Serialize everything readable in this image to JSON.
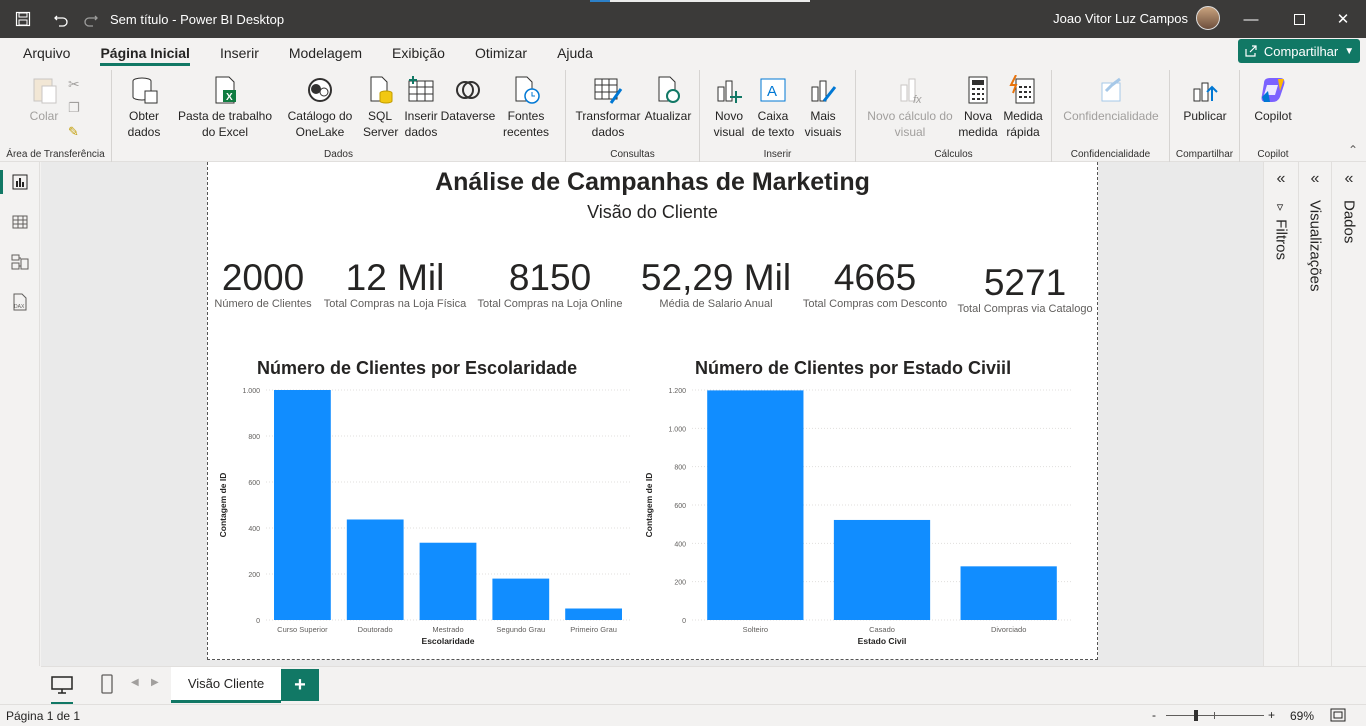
{
  "window": {
    "title": "Sem título - Power BI Desktop",
    "user": "Joao Vitor Luz Campos"
  },
  "ribbon_tabs": [
    "Arquivo",
    "Página Inicial",
    "Inserir",
    "Modelagem",
    "Exibição",
    "Otimizar",
    "Ajuda"
  ],
  "active_tab": "Página Inicial",
  "share_label": "Compartilhar",
  "ribbon": {
    "clipboard": {
      "paste": "Colar",
      "group": "Área de Transferência"
    },
    "data": {
      "get_data": "Obter dados",
      "excel": "Pasta de trabalho do Excel",
      "onelake": "Catálogo do OneLake",
      "sql": "SQL Server",
      "enter_data": "Inserir dados",
      "dataverse": "Dataverse",
      "recent": "Fontes recentes",
      "group": "Dados"
    },
    "queries": {
      "transform": "Transformar dados",
      "refresh": "Atualizar",
      "group": "Consultas"
    },
    "insert": {
      "new_visual": "Novo visual",
      "text_box": "Caixa de texto",
      "more_visuals": "Mais visuais",
      "group": "Inserir"
    },
    "calculations": {
      "new_calc": "Novo cálculo do visual",
      "new_measure": "Nova medida",
      "quick_measure": "Medida rápida",
      "group": "Cálculos"
    },
    "sensitivity": {
      "btn": "Confidencialidade",
      "group": "Confidencialidade"
    },
    "share": {
      "publish": "Publicar",
      "group": "Compartilhar"
    },
    "copilot": {
      "btn": "Copilot",
      "group": "Copilot"
    }
  },
  "report": {
    "title": "Análise de Campanhas de Marketing",
    "subtitle": "Visão do Cliente",
    "kpis": [
      {
        "value": "2000",
        "label": "Número de Clientes"
      },
      {
        "value": "12 Mil",
        "label": "Total Compras na Loja Física"
      },
      {
        "value": "8150",
        "label": "Total Compras na Loja Online"
      },
      {
        "value": "52,29 Mil",
        "label": "Média de Salario Anual"
      },
      {
        "value": "4665",
        "label": "Total Compras com Desconto"
      },
      {
        "value": "5271",
        "label": "Total Compras via Catalogo"
      }
    ]
  },
  "chart_data": [
    {
      "type": "bar",
      "title": "Número de Clientes por Escolaridade",
      "xlabel": "Escolaridade",
      "ylabel": "Contagem de ID",
      "categories": [
        "Curso Superior",
        "Doutorado",
        "Mestrado",
        "Segundo Grau",
        "Primeiro Grau"
      ],
      "values": [
        1000,
        437,
        336,
        180,
        50
      ],
      "ylim": [
        0,
        1000
      ],
      "yticks": [
        0,
        200,
        400,
        600,
        800,
        1000
      ],
      "ytick_labels": [
        "0",
        "200",
        "400",
        "600",
        "800",
        "1.000"
      ],
      "color": "#118dff",
      "grid": true
    },
    {
      "type": "bar",
      "title": "Número de Clientes por Estado Civiil",
      "xlabel": "Estado Civil",
      "ylabel": "Contagem de ID",
      "categories": [
        "Solteiro",
        "Casado",
        "Divorciado"
      ],
      "values": [
        1198,
        522,
        280
      ],
      "ylim": [
        0,
        1200
      ],
      "yticks": [
        0,
        200,
        400,
        600,
        800,
        1000,
        1200
      ],
      "ytick_labels": [
        "0",
        "200",
        "400",
        "600",
        "800",
        "1.000",
        "1.200"
      ],
      "color": "#118dff",
      "grid": true
    }
  ],
  "panes": {
    "filters": "Filtros",
    "visualizations": "Visualizações",
    "data": "Dados"
  },
  "page_tab": "Visão Cliente",
  "add_page": "+",
  "status": {
    "page": "Página 1 de 1",
    "zoom": "69%",
    "zoom_minus": "-",
    "zoom_plus": "+"
  }
}
